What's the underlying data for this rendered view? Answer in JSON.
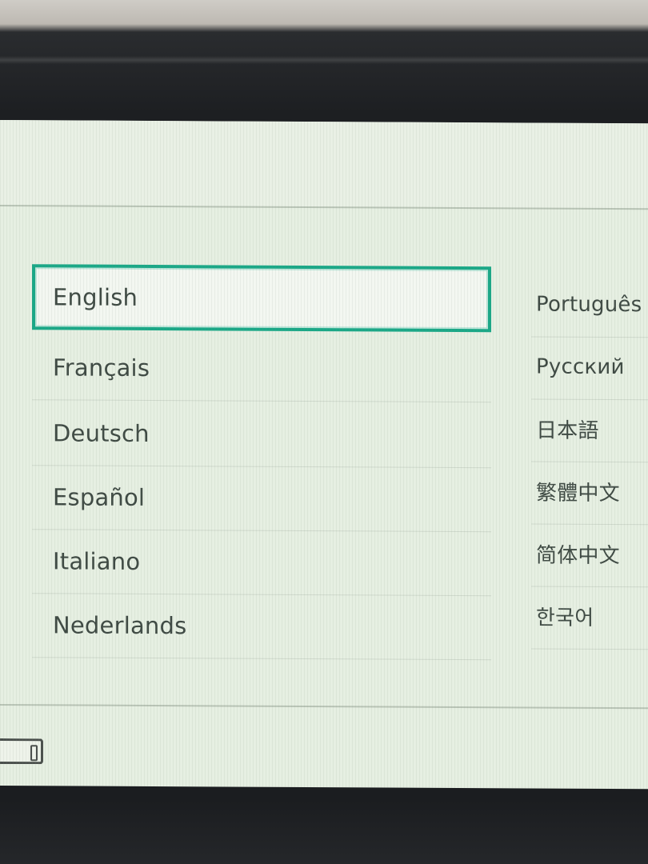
{
  "languages_left": [
    {
      "label": "English",
      "selected": true
    },
    {
      "label": "Français",
      "selected": false
    },
    {
      "label": "Deutsch",
      "selected": false
    },
    {
      "label": "Español",
      "selected": false
    },
    {
      "label": "Italiano",
      "selected": false
    },
    {
      "label": "Nederlands",
      "selected": false
    }
  ],
  "languages_right": [
    {
      "label": "Português"
    },
    {
      "label": "Русский"
    },
    {
      "label": "日本語"
    },
    {
      "label": "繁體中文"
    },
    {
      "label": "简体中文"
    },
    {
      "label": "한국어"
    }
  ],
  "colors": {
    "selection_border": "#1aa887",
    "screen_background": "#e6efe2",
    "text": "#3f4a44"
  },
  "icons": {
    "bottom_left_control": "button-glyph-icon"
  }
}
